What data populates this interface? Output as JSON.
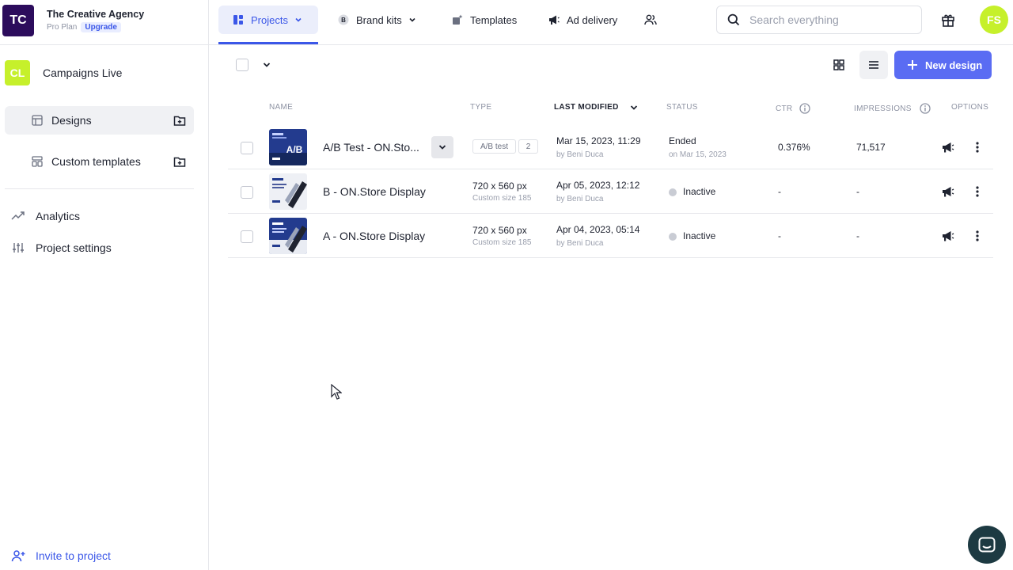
{
  "org": {
    "logo": "TC",
    "name": "The Creative Agency",
    "plan": "Pro Plan",
    "upgrade": "Upgrade"
  },
  "project": {
    "logo": "CL",
    "name": "Campaigns Live"
  },
  "sidebar": {
    "items": [
      {
        "label": "Designs",
        "icon": "layout-icon",
        "active": true
      },
      {
        "label": "Custom templates",
        "icon": "template-icon",
        "active": false
      }
    ],
    "links": [
      {
        "label": "Analytics",
        "icon": "trend-icon"
      },
      {
        "label": "Project settings",
        "icon": "sliders-icon"
      }
    ],
    "invite": "Invite to project"
  },
  "topbar": {
    "tabs": [
      {
        "label": "Projects",
        "icon": "dashboard-icon",
        "active": true
      },
      {
        "label": "Brand kits",
        "icon": "brand-b-icon"
      },
      {
        "label": "Templates",
        "icon": "sparkle-icon"
      },
      {
        "label": "Ad delivery",
        "icon": "megaphone-icon"
      }
    ],
    "search_placeholder": "Search everything",
    "avatar": "FS"
  },
  "toolbar": {
    "new_design": "New design"
  },
  "table": {
    "headers": {
      "name": "NAME",
      "type": "TYPE",
      "modified": "LAST MODIFIED",
      "status": "STATUS",
      "ctr": "CTR",
      "impressions": "IMPRESSIONS",
      "options": "OPTIONS"
    },
    "rows": [
      {
        "name": "A/B Test - ON.Sto...",
        "type_tag": "A/B test",
        "type_count": "2",
        "modified": "Mar 15, 2023, 11:29",
        "by": "by Beni Duca",
        "status": "Ended",
        "status_sub": "on Mar 15, 2023",
        "ctr": "0.376%",
        "impressions": "71,517"
      },
      {
        "name": "B - ON.Store Display",
        "size": "720 x 560 px",
        "size_sub": "Custom size 185",
        "modified": "Apr 05, 2023, 12:12",
        "by": "by Beni Duca",
        "status": "Inactive",
        "ctr": "-",
        "impressions": "-"
      },
      {
        "name": "A - ON.Store Display",
        "size": "720 x 560 px",
        "size_sub": "Custom size 185",
        "modified": "Apr 04, 2023, 05:14",
        "by": "by Beni Duca",
        "status": "Inactive",
        "ctr": "-",
        "impressions": "-"
      }
    ]
  },
  "colors": {
    "accent": "#3b57e8",
    "primary_button": "#5a6cf3",
    "org_logo": "#2c0c5c",
    "lime": "#c6f02b",
    "chat": "#1d3a42"
  }
}
